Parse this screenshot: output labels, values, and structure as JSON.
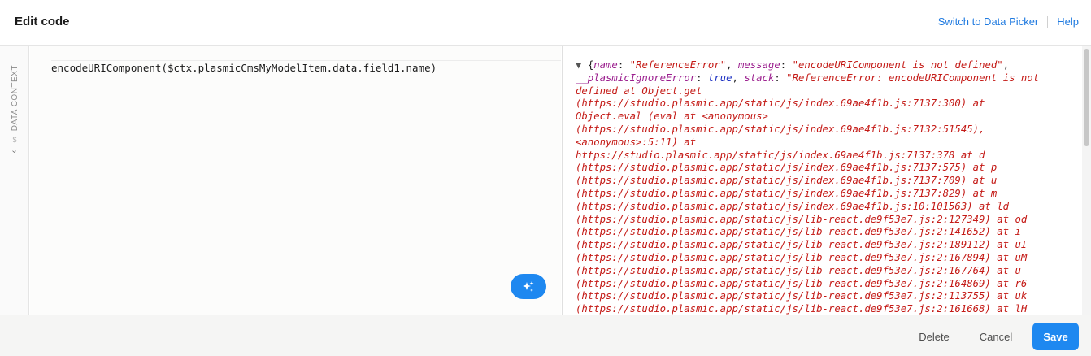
{
  "header": {
    "title": "Edit code",
    "switch_link": "Switch to Data Picker",
    "help_link": "Help"
  },
  "sidebar": {
    "tab_label": "Data Context",
    "tab_symbol": "$",
    "tab_chevron": "›"
  },
  "editor": {
    "code": "encodeURIComponent($ctx.plasmicCmsMyModelItem.data.field1.name)",
    "ai_icon": "sparkle-icon"
  },
  "preview": {
    "toggle": "▼",
    "open_brace": "{",
    "k_name": "name",
    "v_name": "\"ReferenceError\"",
    "k_message": "message",
    "v_message": "\"encodeURIComponent is not defined\"",
    "k_ignore": "__plasmicIgnoreError",
    "v_ignore": "true",
    "k_stack": "stack",
    "stack_lines": [
      "\"ReferenceError: encodeURIComponent is not",
      "defined at Object.get",
      "(https://studio.plasmic.app/static/js/index.69ae4f1b.js:7137:300) at",
      "Object.eval (eval at <anonymous>",
      "(https://studio.plasmic.app/static/js/index.69ae4f1b.js:7132:51545),",
      "<anonymous>:5:11) at",
      "https://studio.plasmic.app/static/js/index.69ae4f1b.js:7137:378 at d",
      "(https://studio.plasmic.app/static/js/index.69ae4f1b.js:7137:575) at p",
      "(https://studio.plasmic.app/static/js/index.69ae4f1b.js:7137:709) at u",
      "(https://studio.plasmic.app/static/js/index.69ae4f1b.js:7137:829) at m",
      "(https://studio.plasmic.app/static/js/index.69ae4f1b.js:10:101563) at ld",
      "(https://studio.plasmic.app/static/js/lib-react.de9f53e7.js:2:127349) at od",
      "(https://studio.plasmic.app/static/js/lib-react.de9f53e7.js:2:141652) at i",
      "(https://studio.plasmic.app/static/js/lib-react.de9f53e7.js:2:189112) at uI",
      "(https://studio.plasmic.app/static/js/lib-react.de9f53e7.js:2:167894) at uM",
      "(https://studio.plasmic.app/static/js/lib-react.de9f53e7.js:2:167764) at u_",
      "(https://studio.plasmic.app/static/js/lib-react.de9f53e7.js:2:164869) at r6",
      "(https://studio.plasmic.app/static/js/lib-react.de9f53e7.js:2:113755) at uk",
      "(https://studio.plasmic.app/static/js/lib-react.de9f53e7.js:2:161668) at lH"
    ]
  },
  "footer": {
    "delete_label": "Delete",
    "cancel_label": "Cancel",
    "save_label": "Save"
  },
  "colors": {
    "accent": "#1e88f0",
    "link": "#1f7ae0",
    "error_text": "#c41a16",
    "key_text": "#9b1e8e",
    "keyword_text": "#1b2fc2"
  }
}
